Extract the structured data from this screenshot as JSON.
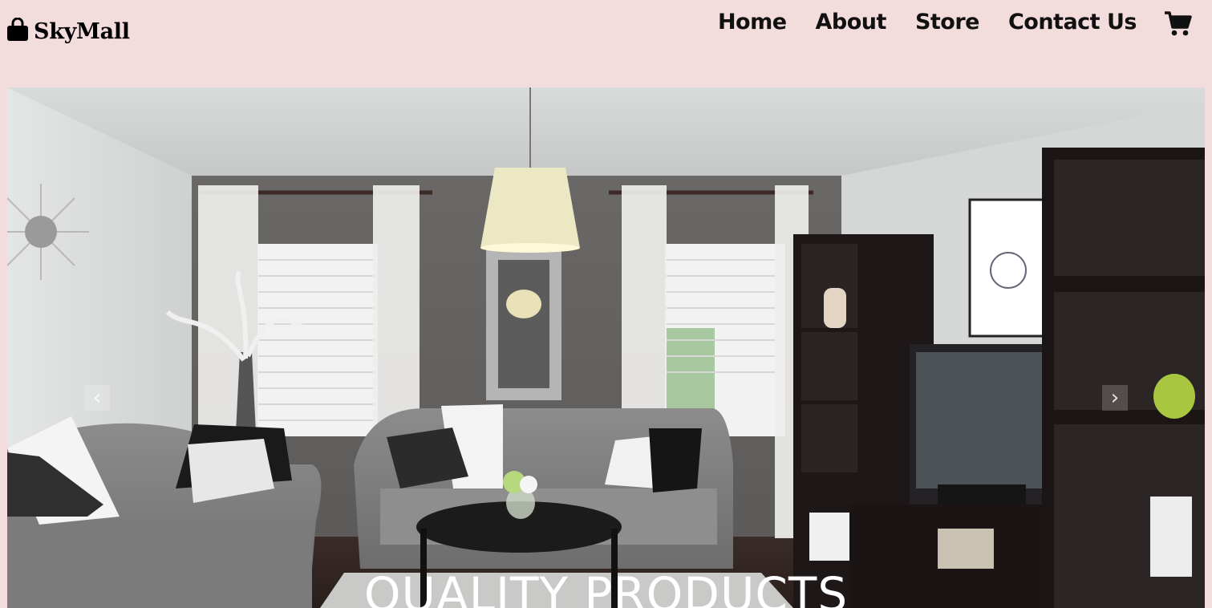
{
  "brand": {
    "name": "SkyMall",
    "icon": "shopping-bag-icon"
  },
  "nav": {
    "items": [
      {
        "label": "Home"
      },
      {
        "label": "About"
      },
      {
        "label": "Store"
      },
      {
        "label": "Contact Us"
      }
    ],
    "cart_icon": "cart-icon"
  },
  "hero": {
    "caption": "QUALITY PRODUCTS",
    "prev_icon": "chevron-left-icon",
    "next_icon": "chevron-right-icon"
  },
  "colors": {
    "navbar_bg": "#f3dcdc",
    "text": "#111111",
    "caption": "#ffffff"
  }
}
